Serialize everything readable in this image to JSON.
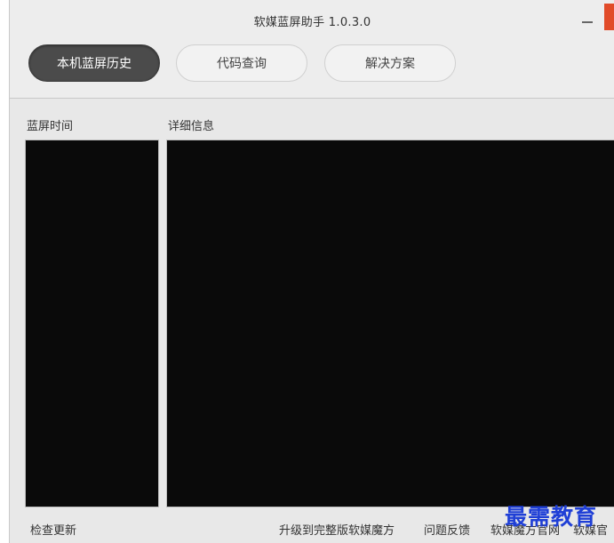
{
  "window": {
    "title": "软媒蓝屏助手 1.0.3.0"
  },
  "tabs": [
    {
      "label": "本机蓝屏历史",
      "active": true
    },
    {
      "label": "代码查询",
      "active": false
    },
    {
      "label": "解决方案",
      "active": false
    }
  ],
  "panels": {
    "time_label": "蓝屏时间",
    "detail_label": "详细信息"
  },
  "footer": {
    "check_update": "检查更新",
    "upgrade": "升级到完整版软媒魔方",
    "feedback": "问题反馈",
    "official_site": "软媒魔方官网",
    "more": "软媒官"
  },
  "watermark": "最需教育",
  "colors": {
    "accent_close": "#e14b29",
    "active_tab": "#4b4b4b",
    "panel_bg": "#0a0a0a"
  }
}
